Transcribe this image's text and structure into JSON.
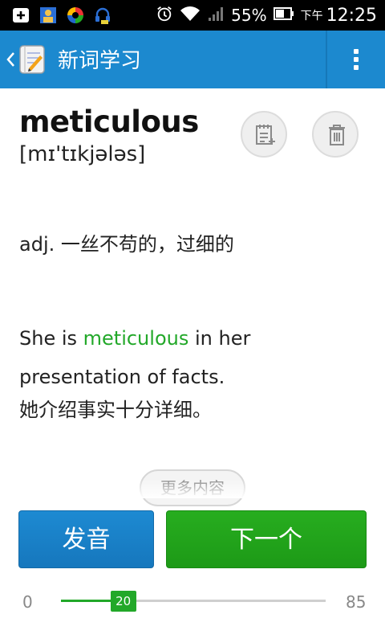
{
  "status_bar": {
    "battery": "55%",
    "ampm": "下午",
    "time": "12:25"
  },
  "header": {
    "title": "新词学习"
  },
  "word": {
    "text": "meticulous",
    "phonetic": "[mɪ'tɪkjələs]"
  },
  "definition": "adj. 一丝不苟的，过细的",
  "example": {
    "before": "She is ",
    "highlight": "meticulous",
    "after": " in her presentation of facts.",
    "translation": "她介绍事实十分详细。"
  },
  "more_button": "更多内容",
  "buttons": {
    "pronounce": "发音",
    "next": "下一个"
  },
  "progress": {
    "min": "0",
    "max": "85",
    "current": "20",
    "current_value": 20,
    "max_value": 85
  },
  "colors": {
    "header": "#1c89cf",
    "accent_green": "#22a829",
    "accent_blue": "#1d8ad2"
  }
}
